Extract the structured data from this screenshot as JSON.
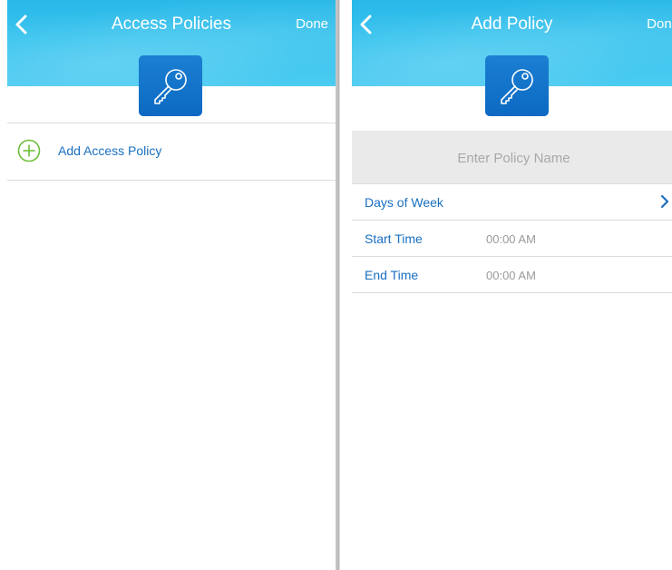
{
  "left_screen": {
    "title": "Access Policies",
    "done_label": "Done",
    "add_policy_label": "Add Access Policy",
    "icons": {
      "back": "chevron-left-icon",
      "key": "key-icon",
      "add": "plus-circle-icon"
    }
  },
  "right_screen": {
    "title": "Add Policy",
    "done_label": "Done",
    "policy_name": {
      "placeholder": "Enter Policy Name",
      "value": ""
    },
    "rows": [
      {
        "label": "Days of Week",
        "value": "",
        "icon": "chevron-right-icon"
      },
      {
        "label": "Start Time",
        "value": "00:00 AM"
      },
      {
        "label": "End Time",
        "value": "00:00 AM"
      }
    ],
    "icons": {
      "back": "chevron-left-icon",
      "key": "key-icon"
    }
  },
  "colors": {
    "header_blue": "#36c3ee",
    "tile_blue": "#0c69c2",
    "link_blue": "#1a6fc0",
    "add_green": "#6cbf3a",
    "value_gray": "#9a9a9a"
  }
}
